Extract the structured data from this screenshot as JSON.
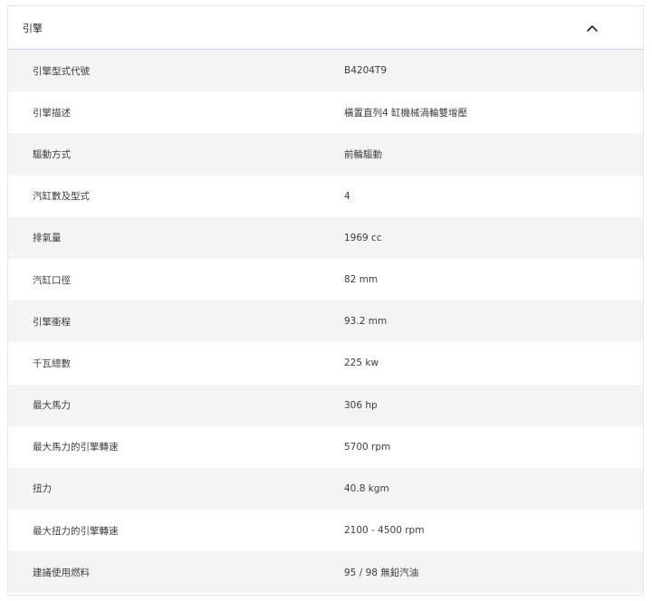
{
  "section": {
    "title": "引擎",
    "toggle_icon": "chevron-up-icon"
  },
  "specs": [
    {
      "label": "引擎型式代號",
      "value": "B4204T9"
    },
    {
      "label": "引擎描述",
      "value": "橫置直列4 缸機械渦輪雙增壓"
    },
    {
      "label": "驅動方式",
      "value": "前輪驅動"
    },
    {
      "label": "汽缸數及型式",
      "value": "4"
    },
    {
      "label": "排氣量",
      "value": "1969 cc"
    },
    {
      "label": "汽缸口徑",
      "value": "82 mm"
    },
    {
      "label": "引擎衝程",
      "value": "93.2 mm"
    },
    {
      "label": "千瓦總數",
      "value": "225 kw"
    },
    {
      "label": "最大馬力",
      "value": "306 hp"
    },
    {
      "label": "最大馬力的引擎轉速",
      "value": "5700 rpm"
    },
    {
      "label": "扭力",
      "value": "40.8 kgm"
    },
    {
      "label": "最大扭力的引擎轉速",
      "value": "2100 - 4500 rpm"
    },
    {
      "label": "建議使用燃料",
      "value": "95 / 98 無鉛汽油"
    }
  ],
  "colors": {
    "row_alt_background": "#f4f4f4",
    "header_border": "#c9d6e6",
    "text": "#3d3d3d"
  }
}
